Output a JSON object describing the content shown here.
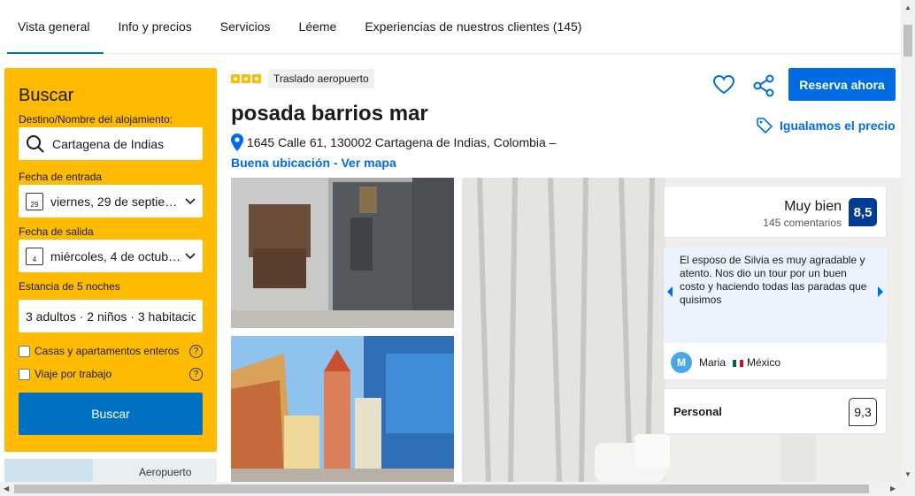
{
  "tabs": [
    {
      "label": "Vista general"
    },
    {
      "label": "Info y precios"
    },
    {
      "label": "Servicios"
    },
    {
      "label": "Léeme"
    },
    {
      "label": "Experiencias de nuestros clientes (145)"
    }
  ],
  "search": {
    "title": "Buscar",
    "destination_label": "Destino/Nombre del alojamiento:",
    "destination_value": "Cartagena de Indias",
    "checkin_label": "Fecha de entrada",
    "checkin_value": "viernes, 29 de septie…",
    "checkin_day": "29",
    "checkout_label": "Fecha de salida",
    "checkout_value": "miércoles, 4 de octub…",
    "checkout_day": "4",
    "stay_label": "Estancia de 5 noches",
    "guests_value": "3 adultos · 2 niños · 3 habitacion",
    "option_apartments": "Casas y apartamentos enteros",
    "option_work": "Viaje por trabajo",
    "button": "Buscar"
  },
  "map": {
    "label": "Aeropuerto"
  },
  "property": {
    "badge": "Traslado aeropuerto",
    "name": "posada barrios mar",
    "address": "1645 Calle 61, 130002 Cartagena de Indias, Colombia –",
    "map_link": "Buena ubicación - Ver mapa",
    "reserve_button": "Reserva ahora",
    "price_match": "Igualamos el precio"
  },
  "rating": {
    "word": "Muy bien",
    "count": "145 comentarios",
    "score": "8,5"
  },
  "review": {
    "text": "El esposo de Silvia es muy agradable y atento. Nos dio un tour por un buen costo y haciendo todas las paradas que quisimos",
    "avatar_letter": "M",
    "author": "Maria",
    "country": "México"
  },
  "staff": {
    "label": "Personal",
    "score": "9,3"
  },
  "colors": {
    "accent": "#006ce4",
    "search_bg": "#febb02",
    "score_bg": "#003b95"
  }
}
